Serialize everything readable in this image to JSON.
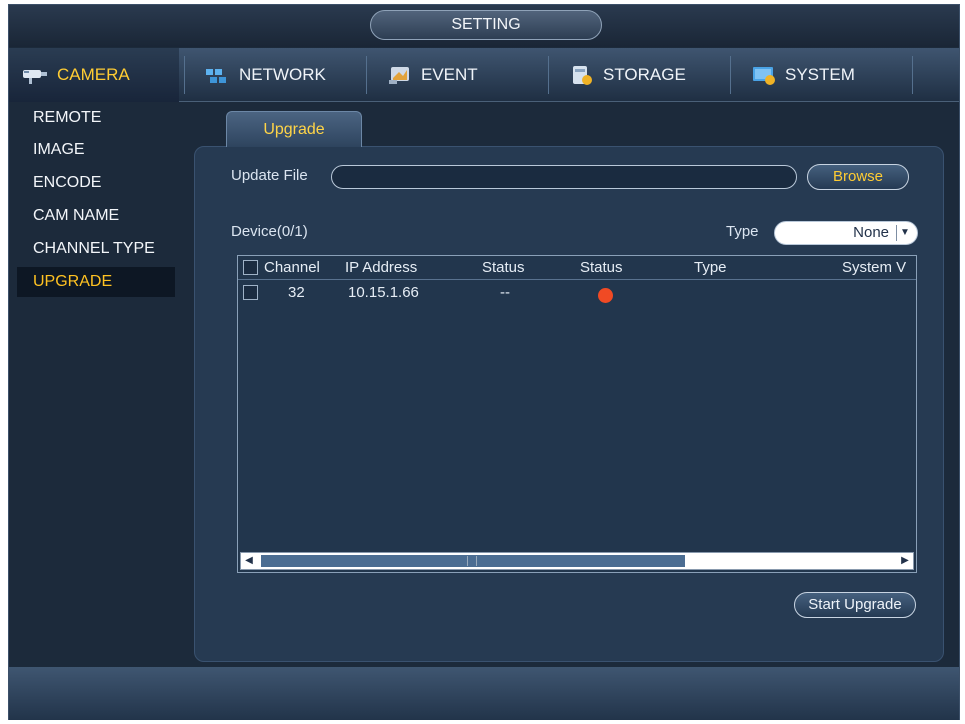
{
  "window": {
    "title": "SETTING"
  },
  "nav": {
    "items": [
      {
        "label": "CAMERA",
        "icon": "camera-icon",
        "active": true
      },
      {
        "label": "NETWORK",
        "icon": "network-icon",
        "active": false
      },
      {
        "label": "EVENT",
        "icon": "event-icon",
        "active": false
      },
      {
        "label": "STORAGE",
        "icon": "storage-icon",
        "active": false
      },
      {
        "label": "SYSTEM",
        "icon": "system-icon",
        "active": false
      }
    ]
  },
  "sidebar": {
    "items": [
      {
        "label": "REMOTE"
      },
      {
        "label": "IMAGE"
      },
      {
        "label": "ENCODE"
      },
      {
        "label": "CAM NAME"
      },
      {
        "label": "CHANNEL TYPE"
      },
      {
        "label": "UPGRADE",
        "active": true
      }
    ]
  },
  "tab": {
    "label": "Upgrade"
  },
  "update_file": {
    "label": "Update File",
    "value": "",
    "browse_label": "Browse"
  },
  "device": {
    "count_label": "Device(0/1)",
    "type_label": "Type",
    "type_value": "None"
  },
  "table": {
    "headers": [
      "Channel",
      "IP Address",
      "Status",
      "Status",
      "Type",
      "System V"
    ],
    "rows": [
      {
        "channel": "32",
        "ip": "10.15.1.66",
        "status": "--",
        "status_color": "#f04a24",
        "type": "",
        "system": ""
      }
    ]
  },
  "actions": {
    "start_upgrade_label": "Start Upgrade"
  },
  "colors": {
    "accent": "#ffcc33",
    "status_offline": "#f04a24"
  }
}
